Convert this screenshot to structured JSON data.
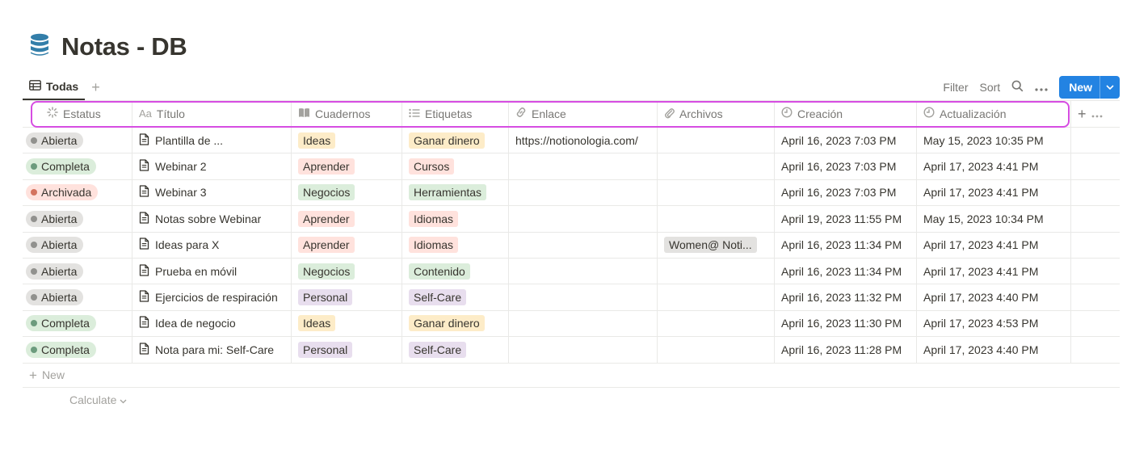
{
  "page": {
    "title": "Notas - DB",
    "icon": "database-icon"
  },
  "views": {
    "active_tab": "Todas",
    "add_view_label": "+"
  },
  "toolbar": {
    "filter_label": "Filter",
    "sort_label": "Sort",
    "new_label": "New"
  },
  "columns": [
    {
      "label": "Estatus",
      "icon": "status-icon"
    },
    {
      "label": "Título",
      "icon": "text-icon",
      "icon_text": "Aa"
    },
    {
      "label": "Cuadernos",
      "icon": "book-icon"
    },
    {
      "label": "Etiquetas",
      "icon": "list-icon"
    },
    {
      "label": "Enlace",
      "icon": "link-icon"
    },
    {
      "label": "Archivos",
      "icon": "paperclip-icon"
    },
    {
      "label": "Creación",
      "icon": "clock-icon"
    },
    {
      "label": "Actualización",
      "icon": "clock-icon"
    }
  ],
  "status_colors": {
    "Abierta": {
      "bg": "#e3e2e0",
      "dot": "#91918e"
    },
    "Completa": {
      "bg": "#dbeddb",
      "dot": "#6c9b7d"
    },
    "Archivada": {
      "bg": "#ffe2dd",
      "dot": "#d4735e"
    }
  },
  "tag_colors": {
    "Ideas": "#fdecc8",
    "Aprender": "#ffe2dd",
    "Negocios": "#dbeddb",
    "Personal": "#e8deee",
    "Ganar dinero": "#fdecc8",
    "Cursos": "#ffe2dd",
    "Herramientas": "#dbeddb",
    "Idiomas": "#ffe2dd",
    "Contenido": "#dbeddb",
    "Self-Care": "#e8deee"
  },
  "rows": [
    {
      "status": "Abierta",
      "title": "Plantilla de ...",
      "cuaderno": "Ideas",
      "etiqueta": "Ganar dinero",
      "enlace": "https://notionologia.com/",
      "archivo": "",
      "creacion": "April 16, 2023 7:03 PM",
      "actualizacion": "May 15, 2023 10:35 PM"
    },
    {
      "status": "Completa",
      "title": "Webinar 2",
      "cuaderno": "Aprender",
      "etiqueta": "Cursos",
      "enlace": "",
      "archivo": "",
      "creacion": "April 16, 2023 7:03 PM",
      "actualizacion": "April 17, 2023 4:41 PM"
    },
    {
      "status": "Archivada",
      "title": "Webinar 3",
      "cuaderno": "Negocios",
      "etiqueta": "Herramientas",
      "enlace": "",
      "archivo": "",
      "creacion": "April 16, 2023 7:03 PM",
      "actualizacion": "April 17, 2023 4:41 PM"
    },
    {
      "status": "Abierta",
      "title": "Notas sobre Webinar",
      "cuaderno": "Aprender",
      "etiqueta": "Idiomas",
      "enlace": "",
      "archivo": "",
      "creacion": "April 19, 2023 11:55 PM",
      "actualizacion": "May 15, 2023 10:34 PM"
    },
    {
      "status": "Abierta",
      "title": "Ideas para X",
      "cuaderno": "Aprender",
      "etiqueta": "Idiomas",
      "enlace": "",
      "archivo": "Women@ Noti...",
      "creacion": "April 16, 2023 11:34 PM",
      "actualizacion": "April 17, 2023 4:41 PM"
    },
    {
      "status": "Abierta",
      "title": "Prueba en móvil",
      "cuaderno": "Negocios",
      "etiqueta": "Contenido",
      "enlace": "",
      "archivo": "",
      "creacion": "April 16, 2023 11:34 PM",
      "actualizacion": "April 17, 2023 4:41 PM"
    },
    {
      "status": "Abierta",
      "title": "Ejercicios de respiración",
      "cuaderno": "Personal",
      "etiqueta": "Self-Care",
      "enlace": "",
      "archivo": "",
      "creacion": "April 16, 2023 11:32 PM",
      "actualizacion": "April 17, 2023 4:40 PM"
    },
    {
      "status": "Completa",
      "title": "Idea de negocio",
      "cuaderno": "Ideas",
      "etiqueta": "Ganar dinero",
      "enlace": "",
      "archivo": "",
      "creacion": "April 16, 2023 11:30 PM",
      "actualizacion": "April 17, 2023 4:53 PM"
    },
    {
      "status": "Completa",
      "title": "Nota para mi: Self-Care",
      "cuaderno": "Personal",
      "etiqueta": "Self-Care",
      "enlace": "",
      "archivo": "",
      "creacion": "April 16, 2023 11:28 PM",
      "actualizacion": "April 17, 2023 4:40 PM"
    }
  ],
  "footer": {
    "new_label": "New",
    "calculate_label": "Calculate"
  },
  "accent": {
    "primary": "#2383e2",
    "highlight": "#d64de2"
  }
}
